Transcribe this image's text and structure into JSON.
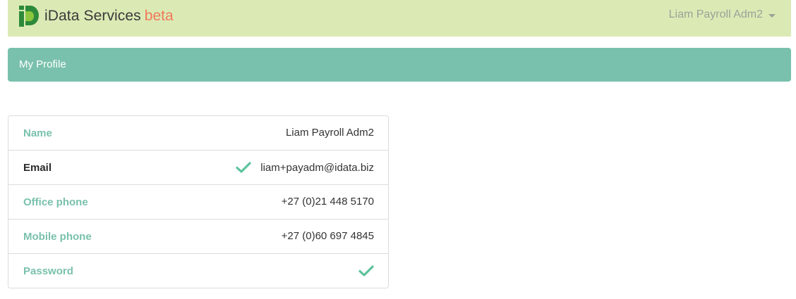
{
  "navbar": {
    "brand_name": "iData Services",
    "brand_tag": "beta",
    "logo_icon": "idata-logo-icon",
    "user_name": "Liam Payroll Adm2"
  },
  "header": {
    "title": "My Profile"
  },
  "profile": {
    "rows": [
      {
        "label": "Name",
        "value": "Liam Payroll Adm2",
        "verified": false
      },
      {
        "label": "Email",
        "value": "liam+payadm@idata.biz",
        "verified": true
      },
      {
        "label": "Office phone",
        "value": "+27 (0)21 448 5170",
        "verified": false
      },
      {
        "label": "Mobile phone",
        "value": "+27 (0)60 697 4845",
        "verified": false
      },
      {
        "label": "Password",
        "value": "",
        "verified": true
      }
    ]
  },
  "colors": {
    "navbar_bg": "#dbeab5",
    "header_bg": "#79c1ac",
    "accent_label": "#79c1ac",
    "beta": "#f0795a",
    "check": "#5cc29b",
    "logo_green": "#2d8a3a"
  }
}
